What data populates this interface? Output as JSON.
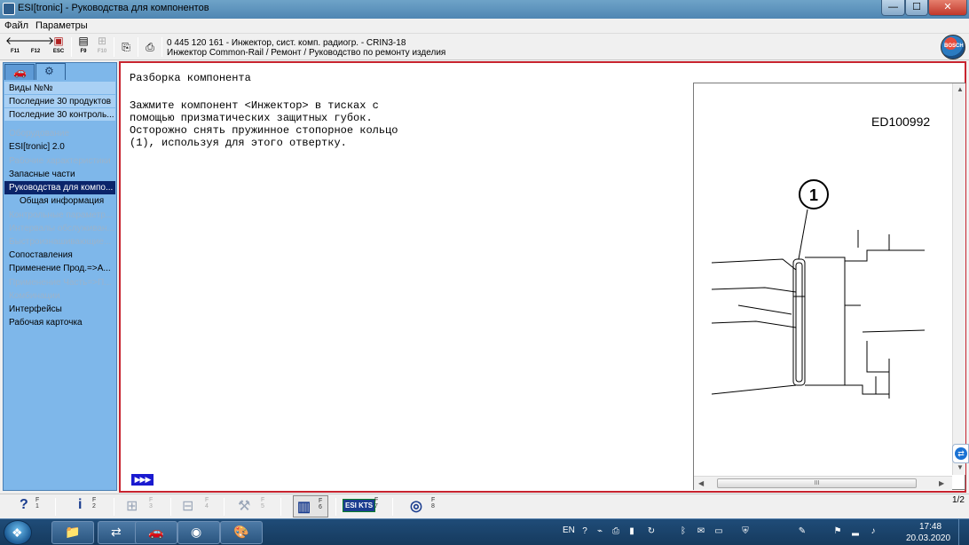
{
  "window": {
    "title": "ESI[tronic] - Руководства для компонентов",
    "minimize": "—",
    "maximize": "☐",
    "close": "✕"
  },
  "menu": {
    "items": [
      "Файл",
      "Параметры"
    ]
  },
  "toolbar": {
    "buttons": [
      {
        "icon": "arrow-left-icon",
        "glyph": "🡐",
        "key": "F11",
        "enabled": true
      },
      {
        "icon": "arrow-right-icon",
        "glyph": "🡒",
        "key": "F12",
        "enabled": true
      },
      {
        "icon": "exit-icon",
        "glyph": "▣",
        "key": "ESC",
        "enabled": true
      },
      {
        "icon": "document-list-icon",
        "glyph": "▤",
        "key": "F9",
        "enabled": true
      },
      {
        "icon": "hierarchy-icon",
        "glyph": "⊞",
        "key": "F10",
        "enabled": false
      },
      {
        "icon": "copy-icon",
        "glyph": "⎘",
        "key": "",
        "enabled": true
      },
      {
        "icon": "print-icon",
        "glyph": "⎙",
        "key": "",
        "enabled": true
      }
    ],
    "header_line1": "0 445 120 161 - Инжектор, сист. комп. радиогр. - CRIN3-18",
    "header_line2": "Инжектор Common-Rail / Ремонт / Руководство по ремонту изделия",
    "logo_text": "BOSCH"
  },
  "sidebar": {
    "tabs": [
      {
        "name": "vehicle",
        "icon": "car-icon",
        "glyph": "🚗"
      },
      {
        "name": "component",
        "icon": "component-icon",
        "glyph": "⚙"
      }
    ],
    "items": [
      {
        "label": "Виды №№",
        "state": "recent"
      },
      {
        "label": "Последние 30 продуктов",
        "state": "recent"
      },
      {
        "label": "Последние 30 контроль...",
        "state": "recent"
      },
      {
        "label": "Оборудование",
        "state": "disabled"
      },
      {
        "label": "ESI[tronic] 2.0",
        "state": "normal"
      },
      {
        "label": "Рабочие характеристики",
        "state": "disabled"
      },
      {
        "label": "Запасные части",
        "state": "normal"
      },
      {
        "label": "Руководства для компо...",
        "state": "selected"
      },
      {
        "label": "Общая информация",
        "state": "sub"
      },
      {
        "label": "Контрольные параметр...",
        "state": "disabled"
      },
      {
        "label": "Интервалы обслуживан...",
        "state": "disabled"
      },
      {
        "label": "Быстроизнашивающие...",
        "state": "disabled"
      },
      {
        "label": "Сопоставления",
        "state": "normal"
      },
      {
        "label": "Применение Прод.=>А...",
        "state": "normal"
      },
      {
        "label": "Применение Часть=>П...",
        "state": "disabled"
      },
      {
        "label": "Комбинации",
        "state": "disabled"
      },
      {
        "label": "Интерфейсы",
        "state": "normal"
      },
      {
        "label": "Рабочая карточка",
        "state": "normal"
      }
    ]
  },
  "document": {
    "title": "Разборка компонента",
    "lines": [
      "Зажмите компонент <Инжектор> в тисках с",
      "помощью призматических защитных губок.",
      "Осторожно снять пружинное стопорное кольцо",
      "(1), используя для этого отвертку."
    ],
    "next_label": "▶▶▶"
  },
  "figure": {
    "code": "ED100992",
    "callout": "1",
    "scroll_grip": "III",
    "scroll_left": "◀",
    "scroll_right": "▶",
    "scroll_up": "▲",
    "scroll_down": "▼"
  },
  "function_bar": {
    "buttons": [
      {
        "icon": "help-icon",
        "glyph": "?",
        "key": "F 1",
        "enabled": true
      },
      {
        "icon": "info-icon",
        "glyph": "i",
        "key": "F 2",
        "enabled": true
      },
      {
        "icon": "diagram-icon",
        "glyph": "⊞",
        "key": "F 3",
        "enabled": false
      },
      {
        "icon": "wiring-icon",
        "glyph": "⊟",
        "key": "F 4",
        "enabled": false
      },
      {
        "icon": "tools-icon",
        "glyph": "⚒",
        "key": "F 5",
        "enabled": false
      },
      {
        "icon": "test-bench-icon",
        "glyph": "▥",
        "key": "F 6",
        "enabled": true
      },
      {
        "icon": "esi-kts-icon",
        "glyph": "ESI KTS",
        "key": "F 7",
        "enabled": true
      },
      {
        "icon": "bosch-service-icon",
        "glyph": "◎",
        "key": "F 8",
        "enabled": true
      }
    ],
    "page_indicator": "1/2"
  },
  "taskbar": {
    "start_glyph": "❖",
    "apps": [
      {
        "icon": "explorer-icon",
        "glyph": "📁"
      },
      {
        "icon": "teamviewer-icon",
        "glyph": "⇄"
      },
      {
        "icon": "esi-app-icon",
        "glyph": "🚗"
      },
      {
        "icon": "dvd-icon",
        "glyph": "◉"
      },
      {
        "icon": "paint-icon",
        "glyph": "🎨"
      }
    ],
    "language": "EN",
    "tray_icons": [
      "help-tray-icon",
      "network-tray-icon",
      "printer-tray-icon",
      "battery-tray-icon",
      "refresh-tray-icon",
      "bluetooth-tray-icon",
      "chat-tray-icon",
      "display-tray-icon",
      "security-tray-icon",
      "tool-tray-icon",
      "flag-tray-icon",
      "signal-tray-icon",
      "volume-tray-icon"
    ],
    "time": "17:48",
    "date": "20.03.2020"
  },
  "colors": {
    "sidebar_bg": "#7eb7ea",
    "selection": "#0a246a",
    "frame_border": "#c8242f",
    "taskbar": "#1f4c78"
  }
}
